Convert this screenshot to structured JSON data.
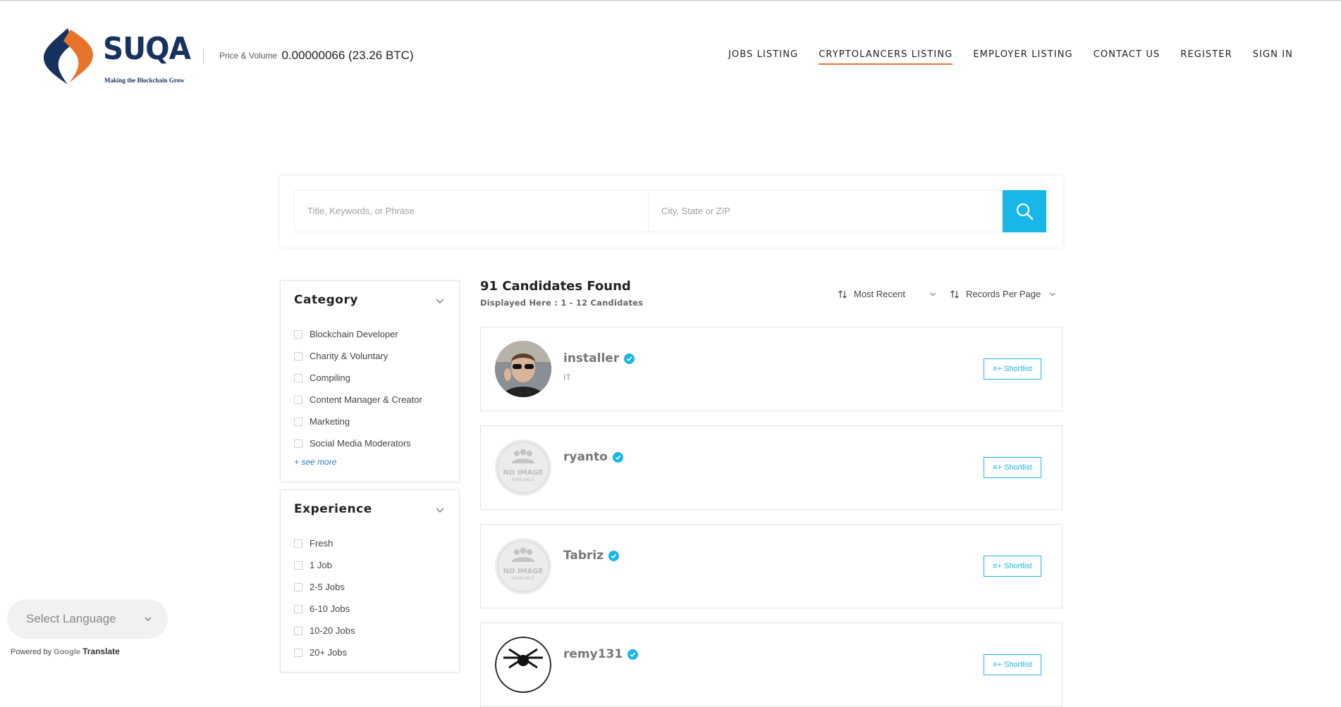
{
  "brand": {
    "name": "SUQA",
    "tagline": "Making the Blockchain Grow",
    "colors": {
      "navy": "#17325f",
      "orange": "#e8742c",
      "accent": "#19b6e9"
    }
  },
  "price": {
    "label": "Price & Volume",
    "value": "0.00000066 (23.26 BTC)"
  },
  "nav": {
    "items": [
      {
        "label": "JOBS LISTING"
      },
      {
        "label": "CRYPTOLANCERS LISTING",
        "active": true
      },
      {
        "label": "EMPLOYER LISTING"
      },
      {
        "label": "CONTACT US"
      },
      {
        "label": "REGISTER"
      },
      {
        "label": "SIGN IN"
      }
    ]
  },
  "search": {
    "keyword_placeholder": "Title, Keywords, or Phrase",
    "location_placeholder": "City, State or ZIP",
    "button_icon": "search-icon"
  },
  "filters": {
    "category": {
      "title": "Category",
      "options": [
        "Blockchain Developer",
        "Charity & Voluntary",
        "Compiling",
        "Content Manager & Creator",
        "Marketing",
        "Social Media Moderators"
      ],
      "see_more": "+ see more"
    },
    "experience": {
      "title": "Experience",
      "options": [
        "Fresh",
        "1 Job",
        "2-5 Jobs",
        "6-10 Jobs",
        "10-20 Jobs",
        "20+ Jobs"
      ]
    }
  },
  "results": {
    "title": "91 Candidates Found",
    "subtitle": "Displayed Here : 1 - 12 Candidates",
    "sort_label": "Most Recent",
    "per_page_label": "Records Per Page",
    "candidates": [
      {
        "name": "installer",
        "category": "IT",
        "avatar": "photo",
        "verified": true
      },
      {
        "name": "ryanto",
        "category": "",
        "avatar": "no-image",
        "verified": true
      },
      {
        "name": "Tabriz",
        "category": "",
        "avatar": "no-image",
        "verified": true
      },
      {
        "name": "remy131",
        "category": "",
        "avatar": "logo",
        "verified": true
      }
    ],
    "shortlist_label": "≡+ Shortlist",
    "no_image_text": "NO IMAGE",
    "no_image_sub": "AVAILABLE"
  },
  "translate": {
    "select_label": "Select Language",
    "powered_by": "Powered by",
    "google": "Google",
    "translate": "Translate"
  }
}
